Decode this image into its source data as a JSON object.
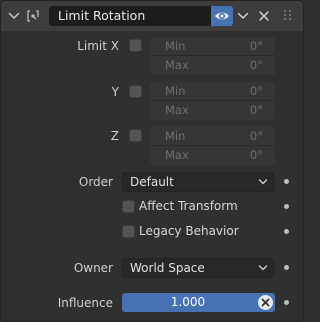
{
  "header": {
    "name": "Limit Rotation",
    "icons": {
      "collapse": "chevron-down-icon",
      "constraint": "constraint-icon",
      "visibility": "eye-icon",
      "menu": "chevron-down-icon",
      "close": "close-icon",
      "drag": "grip-icon"
    }
  },
  "limits": [
    {
      "axis_label": "Limit X",
      "min_label": "Min",
      "min_value": "0°",
      "max_label": "Max",
      "max_value": "0°"
    },
    {
      "axis_label": "Y",
      "min_label": "Min",
      "min_value": "0°",
      "max_label": "Max",
      "max_value": "0°"
    },
    {
      "axis_label": "Z",
      "min_label": "Min",
      "min_value": "0°",
      "max_label": "Max",
      "max_value": "0°"
    }
  ],
  "order": {
    "label": "Order",
    "value": "Default"
  },
  "affect_transform": {
    "label": "Affect Transform",
    "checked": false
  },
  "legacy_behavior": {
    "label": "Legacy Behavior",
    "checked": false
  },
  "owner": {
    "label": "Owner",
    "value": "World Space"
  },
  "influence": {
    "label": "Influence",
    "value": "1.000",
    "fraction": 1.0
  },
  "colors": {
    "accent": "#4772b3",
    "panel_bg": "#303030",
    "header_bg": "#3d3d3d"
  }
}
